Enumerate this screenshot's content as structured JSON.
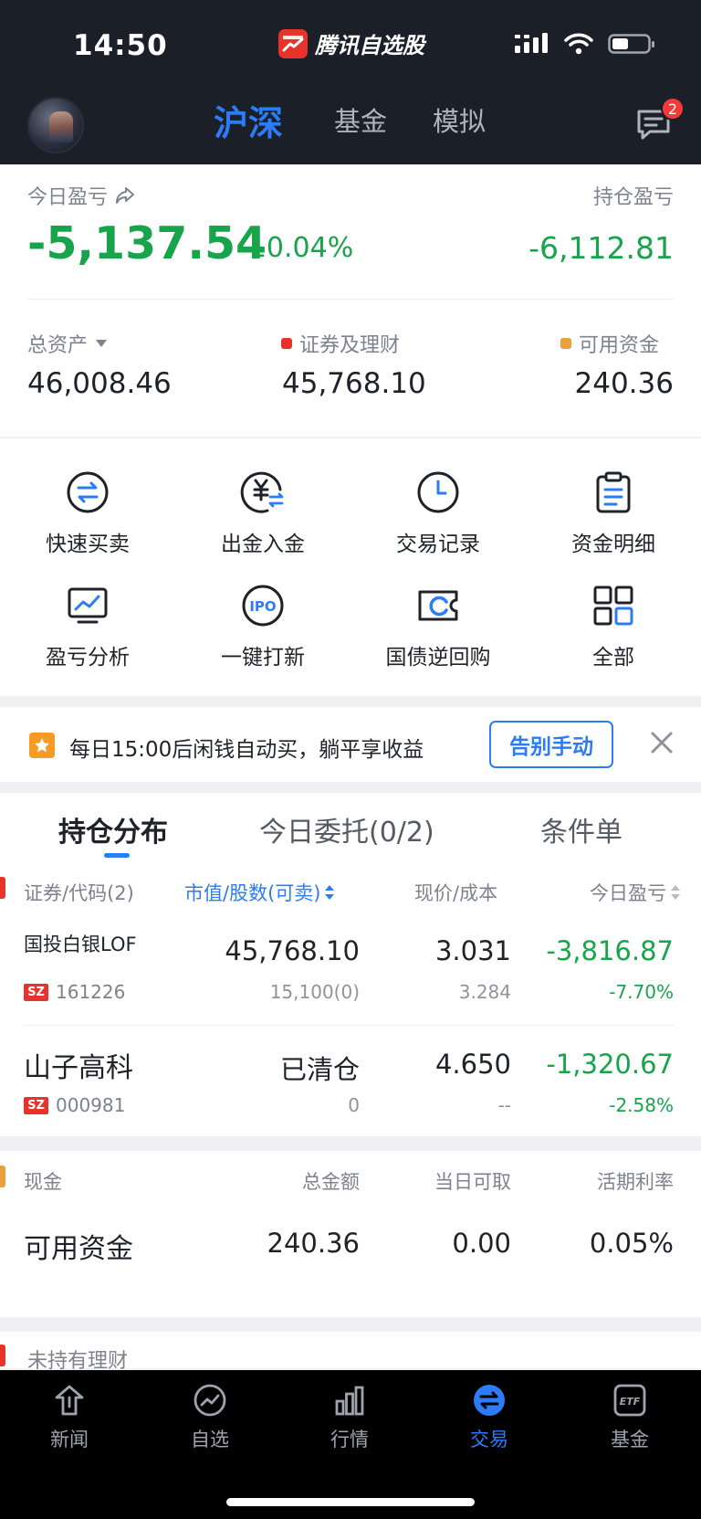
{
  "status_bar": {
    "time": "14:50",
    "app_name": "腾讯自选股"
  },
  "topnav": {
    "tabs": [
      {
        "label": "沪深",
        "active": true
      },
      {
        "label": "基金"
      },
      {
        "label": "模拟"
      }
    ],
    "message_badge": "2"
  },
  "pnl": {
    "today_label": "今日盈亏",
    "today_value": "-5,137.54",
    "today_pct": "-10.04%",
    "hold_label": "持仓盈亏",
    "hold_value": "-6,112.81"
  },
  "assets": {
    "total_label": "总资产",
    "total_value": "46,008.46",
    "securities_label": "证券及理财",
    "securities_value": "45,768.10",
    "available_label": "可用资金",
    "available_value": "240.36",
    "colors": {
      "securities": "#e8332c",
      "available": "#e9a23b"
    }
  },
  "actions": [
    {
      "label": "快速买卖",
      "icon": "exchange-icon"
    },
    {
      "label": "出金入金",
      "icon": "yuan-transfer-icon"
    },
    {
      "label": "交易记录",
      "icon": "clock-icon"
    },
    {
      "label": "资金明细",
      "icon": "clipboard-icon"
    },
    {
      "label": "盈亏分析",
      "icon": "chart-monitor-icon"
    },
    {
      "label": "一键打新",
      "icon": "ipo-icon"
    },
    {
      "label": "国债逆回购",
      "icon": "bond-ticket-icon"
    },
    {
      "label": "全部",
      "icon": "grid-icon"
    }
  ],
  "promo": {
    "text": "每日15:00后闲钱自动买，躺平享收益",
    "button": "告别手动"
  },
  "holdings": {
    "tabs": [
      {
        "label": "持仓分布",
        "active": true
      },
      {
        "label": "今日委托(0/2)"
      },
      {
        "label": "条件单"
      }
    ],
    "headers": {
      "security": "证券/代码(2)",
      "market_value": "市值/股数(可卖)",
      "price": "现价/成本",
      "today_pnl": "今日盈亏"
    },
    "rows": [
      {
        "name": "国投白银LOF",
        "market": "SZ",
        "code": "161226",
        "market_value": "45,768.10",
        "shares": "15,100(0)",
        "price": "3.031",
        "cost": "3.284",
        "pnl": "-3,816.87",
        "pnl_pct": "-7.70%"
      },
      {
        "name": "山子高科",
        "market": "SZ",
        "code": "000981",
        "market_value": "已清仓",
        "shares": "0",
        "price": "4.650",
        "cost": "--",
        "pnl": "-1,320.67",
        "pnl_pct": "-2.58%"
      }
    ]
  },
  "cash": {
    "headers": {
      "type": "现金",
      "total": "总金额",
      "withdrawable": "当日可取",
      "rate": "活期利率"
    },
    "row": {
      "name": "可用资金",
      "total": "240.36",
      "withdrawable": "0.00",
      "rate": "0.05%"
    }
  },
  "wealth_partial": {
    "label": "未持有理财"
  },
  "tabbar": [
    {
      "label": "新闻",
      "icon": "news-icon"
    },
    {
      "label": "自选",
      "icon": "watchlist-icon"
    },
    {
      "label": "行情",
      "icon": "market-icon"
    },
    {
      "label": "交易",
      "icon": "trade-icon",
      "active": true
    },
    {
      "label": "基金",
      "icon": "etf-icon"
    }
  ]
}
